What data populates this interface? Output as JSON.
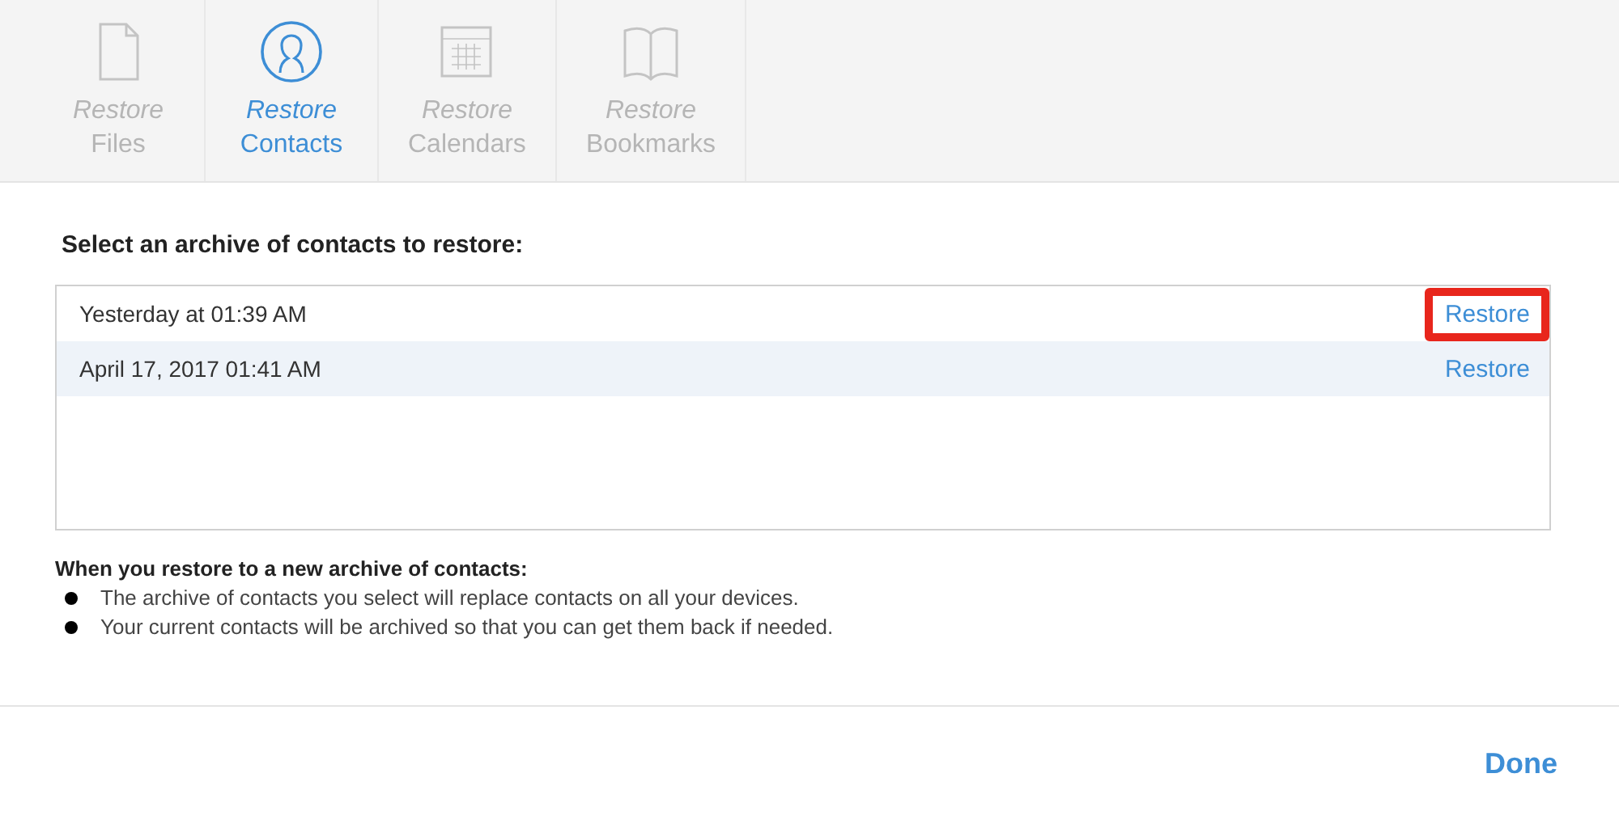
{
  "tabs": [
    {
      "kind": "file",
      "line1": "Restore",
      "line2": "Files",
      "selected": false
    },
    {
      "kind": "contacts",
      "line1": "Restore",
      "line2": "Contacts",
      "selected": true
    },
    {
      "kind": "calendar",
      "line1": "Restore",
      "line2": "Calendars",
      "selected": false
    },
    {
      "kind": "book",
      "line1": "Restore",
      "line2": "Bookmarks",
      "selected": false
    }
  ],
  "heading": "Select an archive of contacts to restore:",
  "archives": [
    {
      "date": "Yesterday at 01:39 AM",
      "action": "Restore",
      "highlighted": true,
      "selected": false
    },
    {
      "date": "April 17, 2017 01:41 AM",
      "action": "Restore",
      "highlighted": false,
      "selected": true
    }
  ],
  "notes": {
    "title": "When you restore to a new archive of contacts:",
    "items": [
      "The archive of contacts you select will replace contacts on all your devices.",
      "Your current contacts will be archived so that you can get them back if needed."
    ]
  },
  "done_button": "Done"
}
